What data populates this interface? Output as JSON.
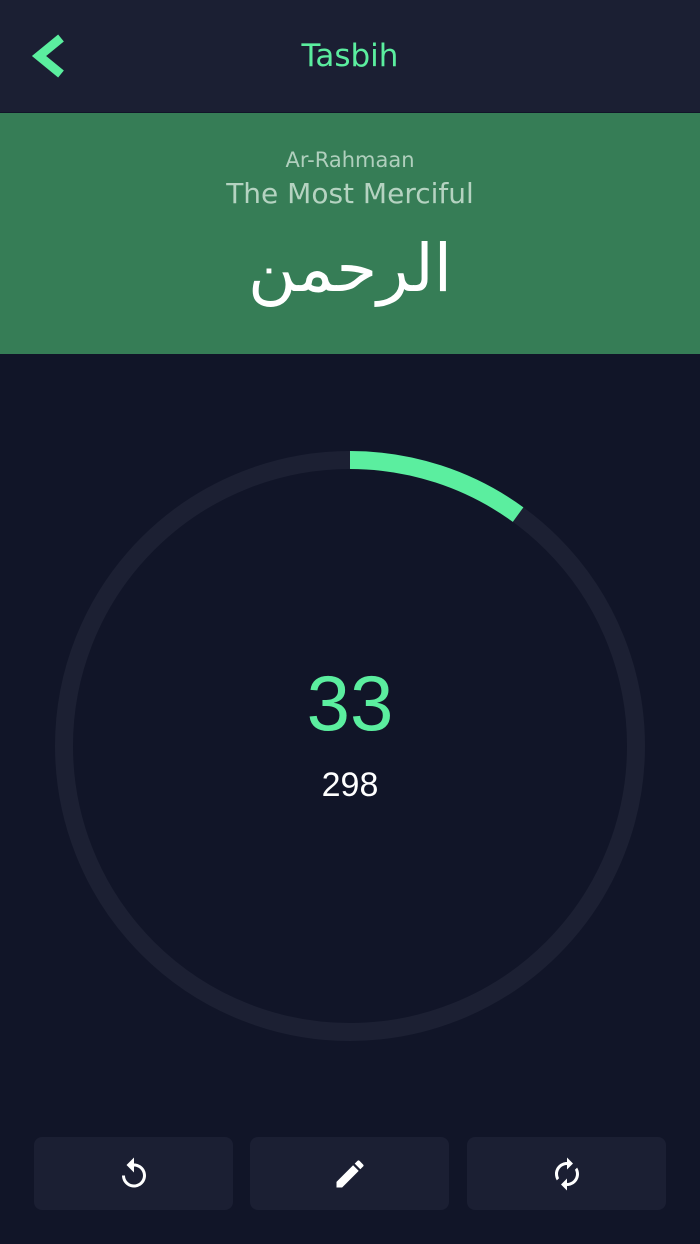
{
  "header": {
    "title": "Tasbih",
    "back_icon": "chevron-left-icon"
  },
  "name": {
    "transliteration": "Ar-Rahmaan",
    "meaning": "The Most Merciful",
    "arabic": "الرحمن"
  },
  "counter": {
    "count": "33",
    "total": "298",
    "progress_fraction": 0.1
  },
  "actions": [
    {
      "icon": "reset-icon"
    },
    {
      "icon": "pencil-icon"
    },
    {
      "icon": "refresh-icon"
    }
  ],
  "colors": {
    "accent": "#5bee9f",
    "banner": "#367d56",
    "background": "#111528",
    "surface": "#1b1f33",
    "ring_track": "#1c2033"
  }
}
